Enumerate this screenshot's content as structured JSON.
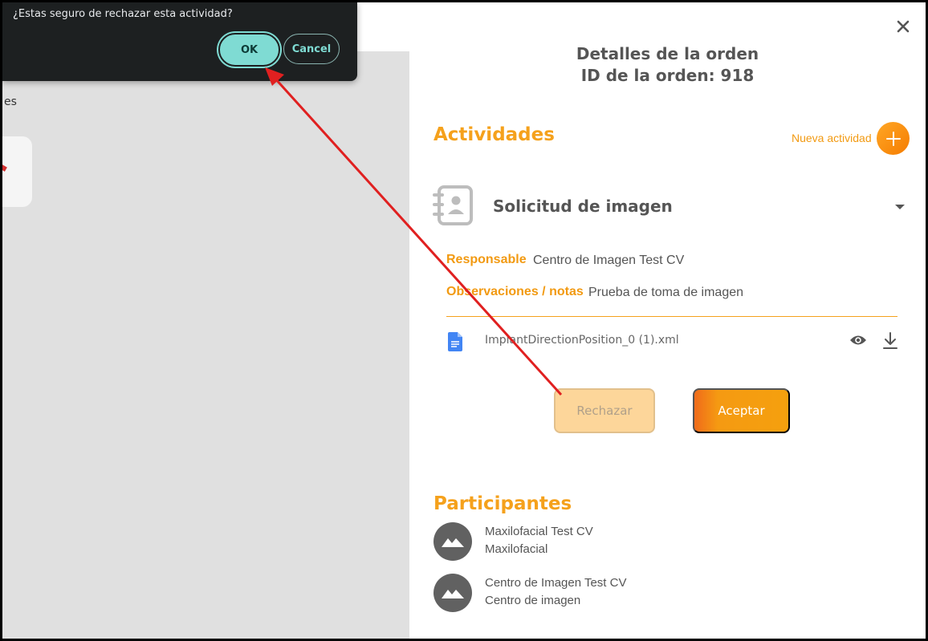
{
  "dialog": {
    "message": "¿Estas seguro de rechazar esta actividad?",
    "ok_label": "OK",
    "cancel_label": "Cancel"
  },
  "background": {
    "fragment_text": "es"
  },
  "panel": {
    "title_line1": "Detalles de la orden",
    "title_line2": "ID de la orden: 918",
    "activities_title": "Actividades",
    "new_activity_label": "Nueva actividad",
    "activity": {
      "name": "Solicitud de imagen",
      "responsable_label": "Responsable",
      "responsable_value": "Centro de Imagen Test CV",
      "notes_label": "Observaciones / notas",
      "notes_value": "Prueba de toma de imagen",
      "file_name": "ImplantDirectionPosition_0 (1).xml",
      "reject_label": "Rechazar",
      "accept_label": "Aceptar"
    },
    "participants_title": "Participantes",
    "participants": [
      {
        "name": "Maxilofacial Test CV",
        "role": "Maxilofacial"
      },
      {
        "name": "Centro de Imagen Test CV",
        "role": "Centro de imagen"
      }
    ]
  },
  "colors": {
    "accent_orange": "#f5a11c",
    "dialog_bg": "#1d2021",
    "ok_teal": "#7fdbd3",
    "annotation_arrow": "#e02020"
  },
  "icons": [
    "close-icon",
    "plus-icon",
    "contacts-book-icon",
    "chevron-down-icon",
    "google-doc-icon",
    "eye-icon",
    "download-icon",
    "image-placeholder-icon"
  ]
}
